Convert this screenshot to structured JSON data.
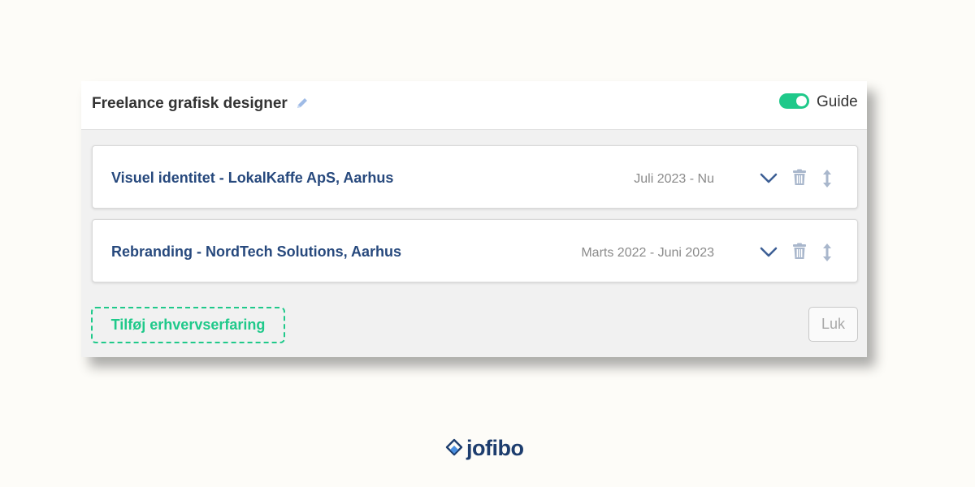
{
  "header": {
    "title": "Freelance grafisk designer",
    "guide_label": "Guide",
    "guide_enabled": true
  },
  "entries": [
    {
      "title": "Visuel identitet - LokalKaffe ApS, Aarhus",
      "date": "Juli 2023 - Nu"
    },
    {
      "title": "Rebranding - NordTech Solutions, Aarhus",
      "date": "Marts 2022 - Juni 2023"
    }
  ],
  "footer": {
    "add_label": "Tilføj erhvervserfaring",
    "close_label": "Luk"
  },
  "brand": {
    "name": "jofibo"
  },
  "colors": {
    "accent": "#1fc98a",
    "title_blue": "#27497d",
    "brand_navy": "#1d3d6e",
    "icon_blue": "#3d5f95"
  },
  "icons": [
    "pencil-icon",
    "chevron-down-icon",
    "trash-icon",
    "move-vertical-icon",
    "brand-logo-icon"
  ]
}
